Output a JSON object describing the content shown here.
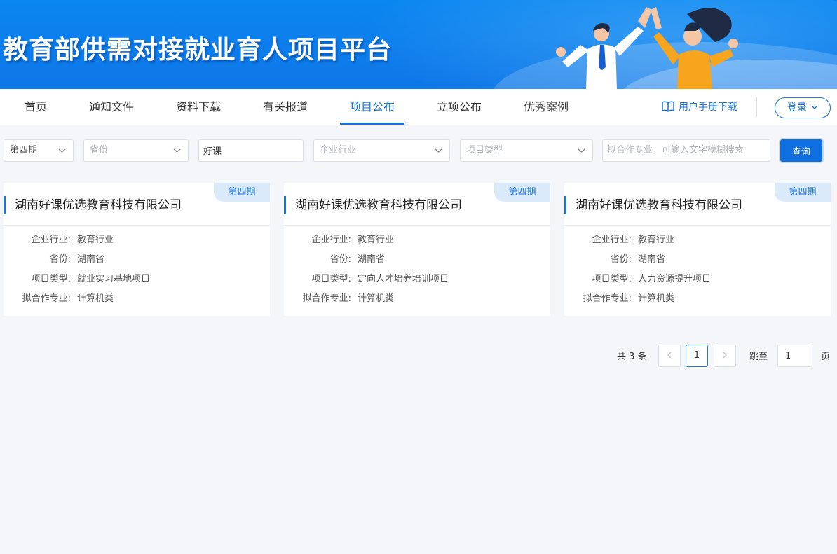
{
  "banner": {
    "title": "教育部供需对接就业育人项目平台"
  },
  "nav": {
    "items": [
      "首页",
      "通知文件",
      "资料下载",
      "有关报道",
      "项目公布",
      "立项公布",
      "优秀案例"
    ],
    "active_index": 4,
    "manual_label": "用户手册下载",
    "login_label": "登录"
  },
  "filters": {
    "period": "第四期",
    "province_placeholder": "省份",
    "keyword_value": "好课",
    "industry_placeholder": "企业行业",
    "project_type_placeholder": "项目类型",
    "major_placeholder": "拟合作专业，可输入文字模糊搜索",
    "query_label": "查询"
  },
  "labels": {
    "industry": "企业行业:",
    "province": "省份:",
    "project_type": "项目类型:",
    "major": "拟合作专业:"
  },
  "cards": [
    {
      "badge": "第四期",
      "title": "湖南好课优选教育科技有限公司",
      "industry": "教育行业",
      "province": "湖南省",
      "project_type": "就业实习基地项目",
      "major": "计算机类"
    },
    {
      "badge": "第四期",
      "title": "湖南好课优选教育科技有限公司",
      "industry": "教育行业",
      "province": "湖南省",
      "project_type": "定向人才培养培训项目",
      "major": "计算机类"
    },
    {
      "badge": "第四期",
      "title": "湖南好课优选教育科技有限公司",
      "industry": "教育行业",
      "province": "湖南省",
      "project_type": "人力资源提升项目",
      "major": "计算机类"
    }
  ],
  "pagination": {
    "total": "共 3 条",
    "current": "1",
    "jump_label": "跳至",
    "jump_value": "1",
    "page_label": "页"
  },
  "colors": {
    "primary": "#1a73d9",
    "banner": "#0a86f0"
  }
}
